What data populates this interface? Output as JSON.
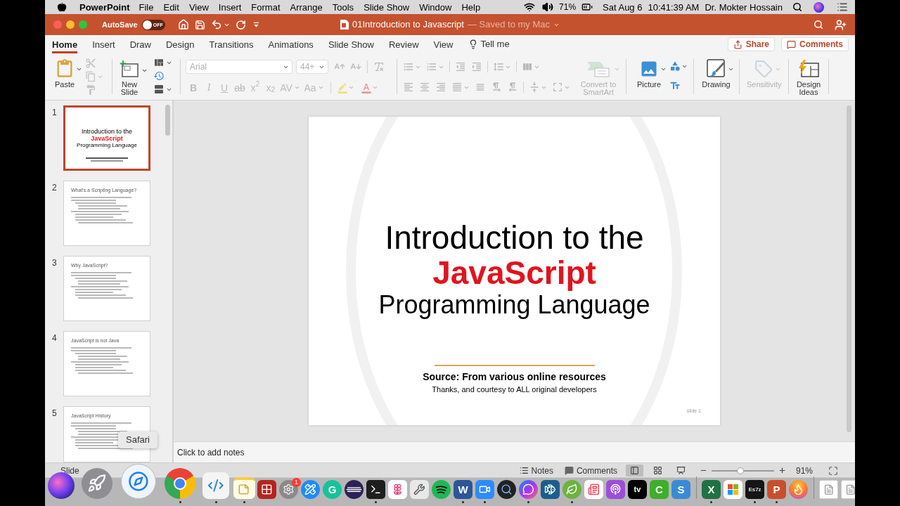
{
  "menu_bar": {
    "app": "PowerPoint",
    "menus": [
      "File",
      "Edit",
      "View",
      "Insert",
      "Format",
      "Arrange",
      "Tools",
      "Slide Show",
      "Window",
      "Help"
    ],
    "battery": "71%",
    "date": "Sat Aug 6",
    "time": "10:41:39 AM",
    "user": "Dr. Mokter Hossain"
  },
  "title_bar": {
    "autosave": {
      "label": "AutoSave",
      "state": "OFF",
      "on": false
    },
    "document": "01Introduction to Javascript",
    "status": "— Saved to my Mac"
  },
  "tabs": [
    {
      "label": "Home",
      "selected": true
    },
    {
      "label": "Insert",
      "selected": false
    },
    {
      "label": "Draw",
      "selected": false
    },
    {
      "label": "Design",
      "selected": false
    },
    {
      "label": "Transitions",
      "selected": false
    },
    {
      "label": "Animations",
      "selected": false
    },
    {
      "label": "Slide Show",
      "selected": false
    },
    {
      "label": "Review",
      "selected": false
    },
    {
      "label": "View",
      "selected": false
    }
  ],
  "tell_me": "Tell me",
  "actions": {
    "share": "Share",
    "comments": "Comments"
  },
  "ribbon": {
    "clipboard": {
      "paste": "Paste",
      "disabled": true
    },
    "new_slide": "New Slide",
    "font": {
      "name": "Arial",
      "size": "44+",
      "disabled": true
    },
    "format_buttons": [
      {
        "kind": "bold",
        "label": "B"
      },
      {
        "kind": "italic",
        "label": "I"
      },
      {
        "kind": "underline",
        "label": "U"
      },
      {
        "kind": "strike",
        "label": "ab"
      },
      {
        "kind": "superscript",
        "label": "x$^{2}$"
      },
      {
        "kind": "subscript",
        "label": "x$_{2}$"
      },
      {
        "kind": "spacing",
        "label": "AV"
      },
      {
        "kind": "case",
        "label": "Aa"
      }
    ],
    "paragraph": {
      "disabled": true
    },
    "smartart": {
      "label": "Convert to SmartArt",
      "disabled": true
    },
    "insert_buttons": [
      {
        "kind": "picture",
        "label": "Picture",
        "disabled": false
      },
      {
        "kind": "drawing",
        "label": "Drawing",
        "disabled": false
      },
      {
        "kind": "sensitivity",
        "label": "Sensitivity",
        "disabled": true
      },
      {
        "kind": "ideas",
        "label": "Design Ideas",
        "disabled": false
      }
    ]
  },
  "thumbnails": [
    {
      "number": "1",
      "selected": true,
      "kind": "title",
      "title": "Introduction to the",
      "highlight": "JavaScript",
      "subtitle": "Programming Language"
    },
    {
      "number": "2",
      "selected": false,
      "kind": "bullets",
      "title": "What's a Scripting Language?"
    },
    {
      "number": "3",
      "selected": false,
      "kind": "bullets",
      "title": "Why JavaScript?"
    },
    {
      "number": "4",
      "selected": false,
      "kind": "bullets",
      "title": "JavaScript is not Java"
    },
    {
      "number": "5",
      "selected": false,
      "kind": "bullets",
      "title": "JavaScript History"
    }
  ],
  "slide": {
    "title": "Introduction to the",
    "highlight": "JavaScript",
    "subtitle": "Programming Language",
    "source": "Source: From various online resources",
    "credit": "Thanks, and courtesy to ALL original developers",
    "footer": "slide 1"
  },
  "notes": {
    "placeholder": "Click to add notes"
  },
  "status_bar": {
    "slide_info": "Slide",
    "notes": "Notes",
    "comments": "Comments",
    "views": [
      {
        "kind": "normal",
        "selected": true
      },
      {
        "kind": "sorter",
        "selected": false
      },
      {
        "kind": "presenter",
        "selected": false
      }
    ],
    "zoom": {
      "level": 0.45,
      "reading": "91%"
    }
  },
  "tooltip": "Safari",
  "dock": {
    "apps": [
      {
        "kind": "siri",
        "running": false,
        "hovered": false
      },
      {
        "kind": "launchpad",
        "running": false,
        "hovered": false
      },
      {
        "kind": "safari",
        "running": false,
        "hovered": true
      },
      {
        "kind": "chrome",
        "running": true,
        "hovered": false
      },
      {
        "kind": "vscode",
        "running": true,
        "hovered": false
      },
      {
        "kind": "notes",
        "running": true,
        "hovered": false
      },
      {
        "kind": "photobooth",
        "running": false,
        "hovered": false
      },
      {
        "kind": "settings",
        "running": false,
        "hovered": false,
        "badge": "1"
      },
      {
        "kind": "appstore",
        "running": false,
        "hovered": false
      },
      {
        "kind": "grammarly",
        "glyph": "G",
        "running": false,
        "hovered": false
      },
      {
        "kind": "eclipse",
        "running": false,
        "hovered": false
      },
      {
        "kind": "terminal",
        "running": true,
        "hovered": false
      },
      {
        "kind": "photos",
        "running": false,
        "hovered": false
      },
      {
        "kind": "tool",
        "running": false,
        "hovered": false
      },
      {
        "kind": "spotify",
        "running": false,
        "hovered": false
      },
      {
        "kind": "word",
        "glyph": "W",
        "running": true,
        "hovered": false
      },
      {
        "kind": "zoom",
        "running": true,
        "hovered": false
      },
      {
        "kind": "quicktime",
        "running": false,
        "hovered": false
      },
      {
        "kind": "messenger",
        "running": true,
        "hovered": false
      },
      {
        "kind": "mysql",
        "running": false,
        "hovered": false
      },
      {
        "kind": "spring",
        "running": true,
        "hovered": false
      },
      {
        "kind": "news",
        "running": false,
        "hovered": false
      },
      {
        "kind": "podcasts",
        "running": false,
        "hovered": false
      },
      {
        "kind": "tv",
        "glyph": "tv",
        "running": false,
        "hovered": false
      },
      {
        "kind": "camtasia",
        "glyph": "C",
        "running": false,
        "hovered": false
      },
      {
        "kind": "scrivener",
        "glyph": "S",
        "running": false,
        "hovered": false
      }
    ],
    "recent_apps": [
      {
        "kind": "excel",
        "glyph": "X",
        "running": true,
        "hovered": false
      },
      {
        "kind": "office",
        "running": false,
        "hovered": false
      },
      {
        "kind": "archiver",
        "glyph": "Es7z",
        "running": true,
        "hovered": false
      },
      {
        "kind": "powerpoint",
        "glyph": "P",
        "running": true,
        "hovered": false
      },
      {
        "kind": "firefox",
        "running": false,
        "hovered": false
      }
    ],
    "stacks": [
      {
        "kind": "document",
        "running": false,
        "hovered": false
      },
      {
        "kind": "document",
        "running": false,
        "hovered": false
      }
    ]
  }
}
